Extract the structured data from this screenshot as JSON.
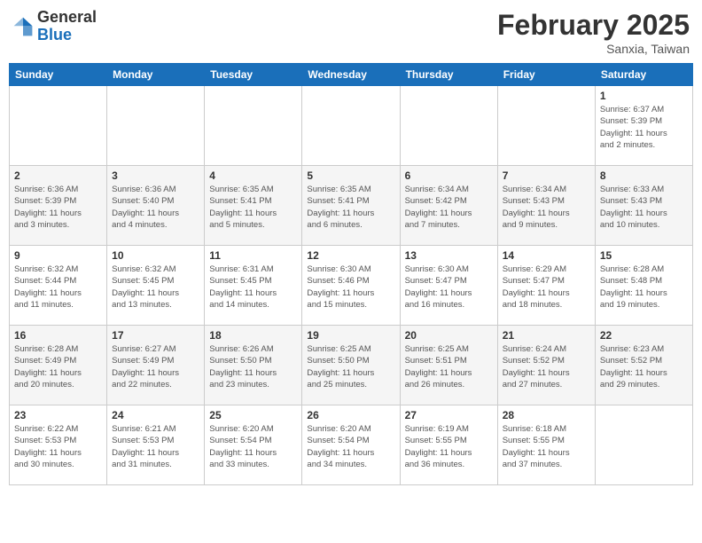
{
  "header": {
    "logo_general": "General",
    "logo_blue": "Blue",
    "month_year": "February 2025",
    "location": "Sanxia, Taiwan"
  },
  "days_of_week": [
    "Sunday",
    "Monday",
    "Tuesday",
    "Wednesday",
    "Thursday",
    "Friday",
    "Saturday"
  ],
  "weeks": [
    [
      {
        "day": "",
        "info": ""
      },
      {
        "day": "",
        "info": ""
      },
      {
        "day": "",
        "info": ""
      },
      {
        "day": "",
        "info": ""
      },
      {
        "day": "",
        "info": ""
      },
      {
        "day": "",
        "info": ""
      },
      {
        "day": "1",
        "info": "Sunrise: 6:37 AM\nSunset: 5:39 PM\nDaylight: 11 hours\nand 2 minutes."
      }
    ],
    [
      {
        "day": "2",
        "info": "Sunrise: 6:36 AM\nSunset: 5:39 PM\nDaylight: 11 hours\nand 3 minutes."
      },
      {
        "day": "3",
        "info": "Sunrise: 6:36 AM\nSunset: 5:40 PM\nDaylight: 11 hours\nand 4 minutes."
      },
      {
        "day": "4",
        "info": "Sunrise: 6:35 AM\nSunset: 5:41 PM\nDaylight: 11 hours\nand 5 minutes."
      },
      {
        "day": "5",
        "info": "Sunrise: 6:35 AM\nSunset: 5:41 PM\nDaylight: 11 hours\nand 6 minutes."
      },
      {
        "day": "6",
        "info": "Sunrise: 6:34 AM\nSunset: 5:42 PM\nDaylight: 11 hours\nand 7 minutes."
      },
      {
        "day": "7",
        "info": "Sunrise: 6:34 AM\nSunset: 5:43 PM\nDaylight: 11 hours\nand 9 minutes."
      },
      {
        "day": "8",
        "info": "Sunrise: 6:33 AM\nSunset: 5:43 PM\nDaylight: 11 hours\nand 10 minutes."
      }
    ],
    [
      {
        "day": "9",
        "info": "Sunrise: 6:32 AM\nSunset: 5:44 PM\nDaylight: 11 hours\nand 11 minutes."
      },
      {
        "day": "10",
        "info": "Sunrise: 6:32 AM\nSunset: 5:45 PM\nDaylight: 11 hours\nand 13 minutes."
      },
      {
        "day": "11",
        "info": "Sunrise: 6:31 AM\nSunset: 5:45 PM\nDaylight: 11 hours\nand 14 minutes."
      },
      {
        "day": "12",
        "info": "Sunrise: 6:30 AM\nSunset: 5:46 PM\nDaylight: 11 hours\nand 15 minutes."
      },
      {
        "day": "13",
        "info": "Sunrise: 6:30 AM\nSunset: 5:47 PM\nDaylight: 11 hours\nand 16 minutes."
      },
      {
        "day": "14",
        "info": "Sunrise: 6:29 AM\nSunset: 5:47 PM\nDaylight: 11 hours\nand 18 minutes."
      },
      {
        "day": "15",
        "info": "Sunrise: 6:28 AM\nSunset: 5:48 PM\nDaylight: 11 hours\nand 19 minutes."
      }
    ],
    [
      {
        "day": "16",
        "info": "Sunrise: 6:28 AM\nSunset: 5:49 PM\nDaylight: 11 hours\nand 20 minutes."
      },
      {
        "day": "17",
        "info": "Sunrise: 6:27 AM\nSunset: 5:49 PM\nDaylight: 11 hours\nand 22 minutes."
      },
      {
        "day": "18",
        "info": "Sunrise: 6:26 AM\nSunset: 5:50 PM\nDaylight: 11 hours\nand 23 minutes."
      },
      {
        "day": "19",
        "info": "Sunrise: 6:25 AM\nSunset: 5:50 PM\nDaylight: 11 hours\nand 25 minutes."
      },
      {
        "day": "20",
        "info": "Sunrise: 6:25 AM\nSunset: 5:51 PM\nDaylight: 11 hours\nand 26 minutes."
      },
      {
        "day": "21",
        "info": "Sunrise: 6:24 AM\nSunset: 5:52 PM\nDaylight: 11 hours\nand 27 minutes."
      },
      {
        "day": "22",
        "info": "Sunrise: 6:23 AM\nSunset: 5:52 PM\nDaylight: 11 hours\nand 29 minutes."
      }
    ],
    [
      {
        "day": "23",
        "info": "Sunrise: 6:22 AM\nSunset: 5:53 PM\nDaylight: 11 hours\nand 30 minutes."
      },
      {
        "day": "24",
        "info": "Sunrise: 6:21 AM\nSunset: 5:53 PM\nDaylight: 11 hours\nand 31 minutes."
      },
      {
        "day": "25",
        "info": "Sunrise: 6:20 AM\nSunset: 5:54 PM\nDaylight: 11 hours\nand 33 minutes."
      },
      {
        "day": "26",
        "info": "Sunrise: 6:20 AM\nSunset: 5:54 PM\nDaylight: 11 hours\nand 34 minutes."
      },
      {
        "day": "27",
        "info": "Sunrise: 6:19 AM\nSunset: 5:55 PM\nDaylight: 11 hours\nand 36 minutes."
      },
      {
        "day": "28",
        "info": "Sunrise: 6:18 AM\nSunset: 5:55 PM\nDaylight: 11 hours\nand 37 minutes."
      },
      {
        "day": "",
        "info": ""
      }
    ]
  ]
}
